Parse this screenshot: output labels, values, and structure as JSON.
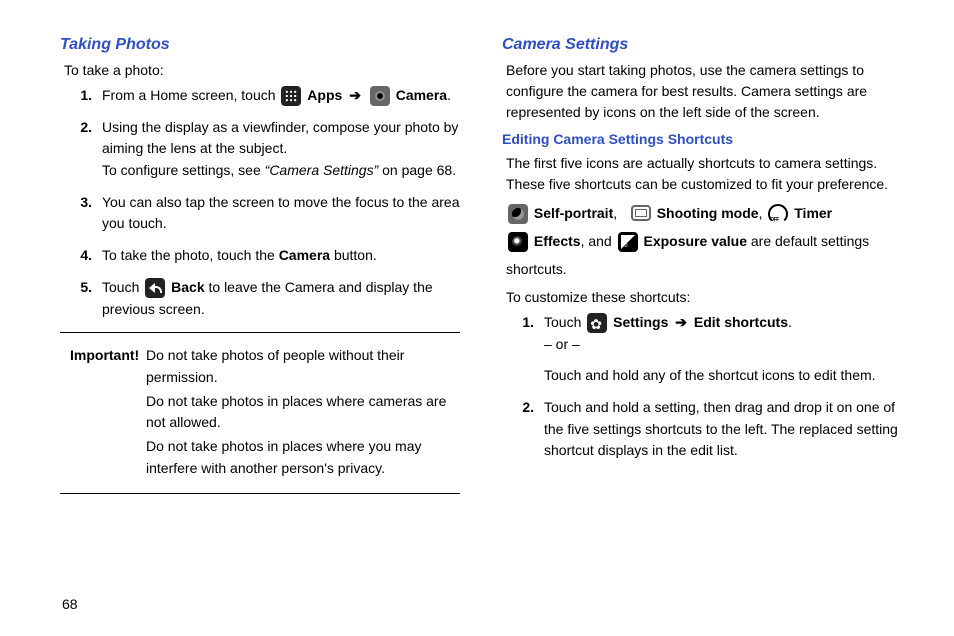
{
  "left": {
    "heading": "Taking Photos",
    "intro": "To take a photo:",
    "steps": [
      {
        "num": "1.",
        "pre": "From a Home screen, touch ",
        "apps": "Apps",
        "arrow": "➔",
        "camera": "Camera",
        "post": "."
      },
      {
        "num": "2.",
        "line1": "Using the display as a viewfinder, compose your photo by aiming the lens at the subject.",
        "line2_pre": "To configure settings, see ",
        "line2_ref": "“Camera Settings”",
        "line2_post": " on page 68."
      },
      {
        "num": "3.",
        "text": "You can also tap the screen to move the focus to the area you touch."
      },
      {
        "num": "4.",
        "pre": "To take the photo, touch the ",
        "bold": "Camera",
        "post": " button."
      },
      {
        "num": "5.",
        "pre": "Touch ",
        "bold": "Back",
        "post": " to leave the Camera and display the previous screen."
      }
    ],
    "important_label": "Important!",
    "important_lines": [
      "Do not take photos of people without their permission.",
      "Do not take photos in places where cameras are not allowed.",
      "Do not take photos in places where you may interfere with another person's privacy."
    ]
  },
  "right": {
    "heading": "Camera Settings",
    "intro": "Before you start taking photos, use the camera settings to configure the camera for best results. Camera settings are represented by icons on the left side of the screen.",
    "sub": "Editing Camera Settings Shortcuts",
    "p1": "The first five icons are actually shortcuts to camera settings. These five shortcuts can be customized to fit your preference.",
    "shortcut_names": {
      "self": "Self-portrait",
      "shoot": "Shooting mode",
      "timer": "Timer",
      "effects": "Effects",
      "exposure": "Exposure value",
      "tail": " are default settings shortcuts."
    },
    "p2": "To customize these shortcuts:",
    "steps": [
      {
        "num": "1.",
        "pre": "Touch ",
        "settings": "Settings",
        "arrow": "➔",
        "edit": "Edit shortcuts",
        "post": ".",
        "or": "– or –",
        "alt": "Touch and hold any of the shortcut icons to edit them."
      },
      {
        "num": "2.",
        "text": "Touch and hold a setting, then drag and drop it on one of the five settings shortcuts to the left. The replaced setting shortcut displays in the edit list."
      }
    ]
  },
  "page_number": "68"
}
